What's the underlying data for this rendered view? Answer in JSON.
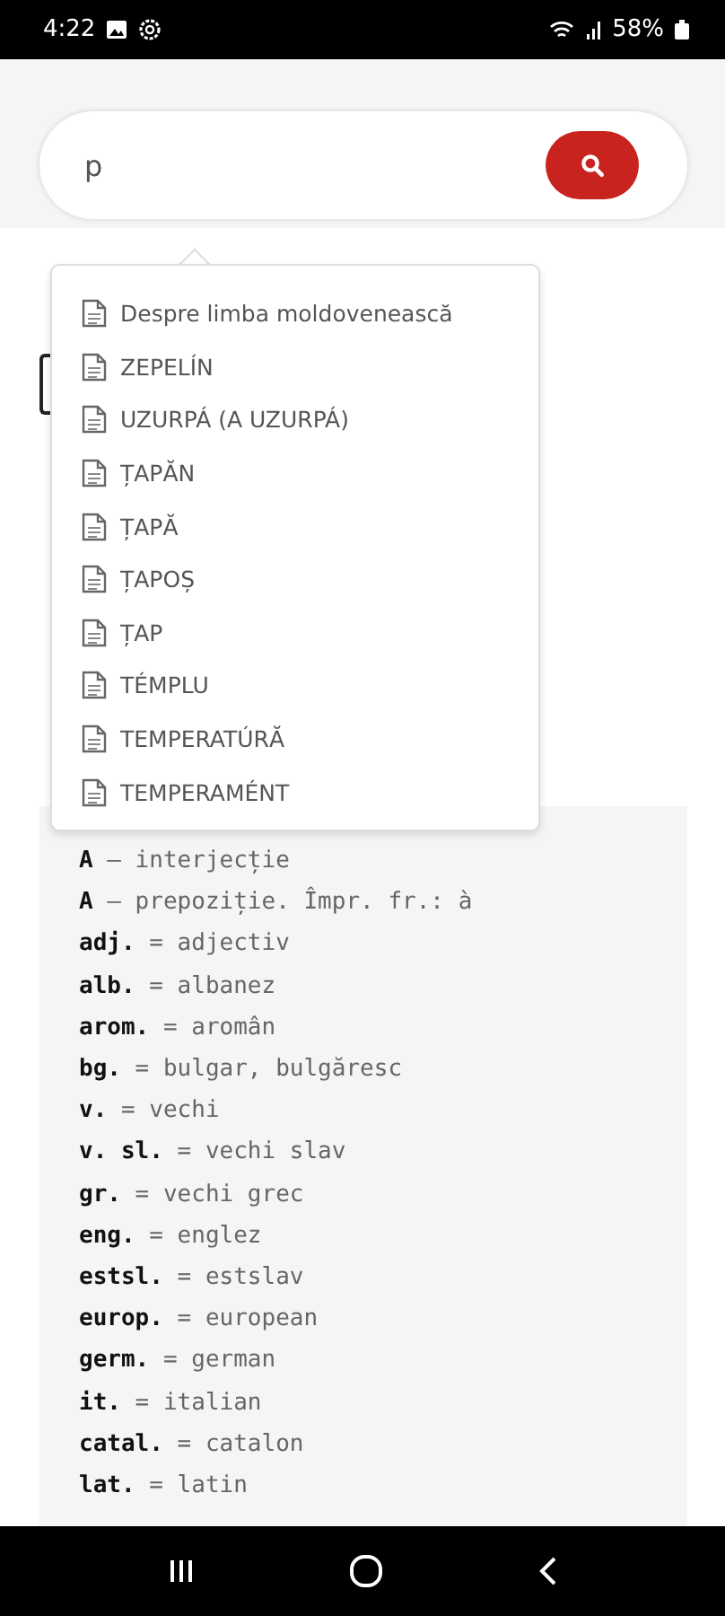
{
  "status_bar": {
    "time": "4:22",
    "battery": "58%"
  },
  "search": {
    "value": "p"
  },
  "suggestions": [
    {
      "label": "Despre limba moldovenească"
    },
    {
      "label": "ZEPELÍN"
    },
    {
      "label": "UZURPÁ (A UZURPÁ)"
    },
    {
      "label": "ȚAPĂN"
    },
    {
      "label": "ȚAPĂ"
    },
    {
      "label": "ȚAPOȘ"
    },
    {
      "label": "ȚAP"
    },
    {
      "label": "TÉMPLU"
    },
    {
      "label": "TEMPERATÚRĂ"
    },
    {
      "label": "TEMPERAMÉNT"
    }
  ],
  "abbreviations": [
    "**A** – interjecție",
    "**A** – prepoziție. Împr. fr.: à",
    "**adj.** = adjectiv",
    "**alb.** = albanez",
    "**arom.** = aromân",
    "**bg.** = bulgar, bulgăresc",
    "**v.** = vechi",
    "**v. sl.** = vechi slav",
    "**gr.** = vechi grec",
    "**eng.** = englez",
    "**estsl.** = estslav",
    "**europ.** = european",
    "**germ.** = german",
    "**it.** = italian",
    "**catal.** = catalon",
    "**lat.** = latin"
  ]
}
